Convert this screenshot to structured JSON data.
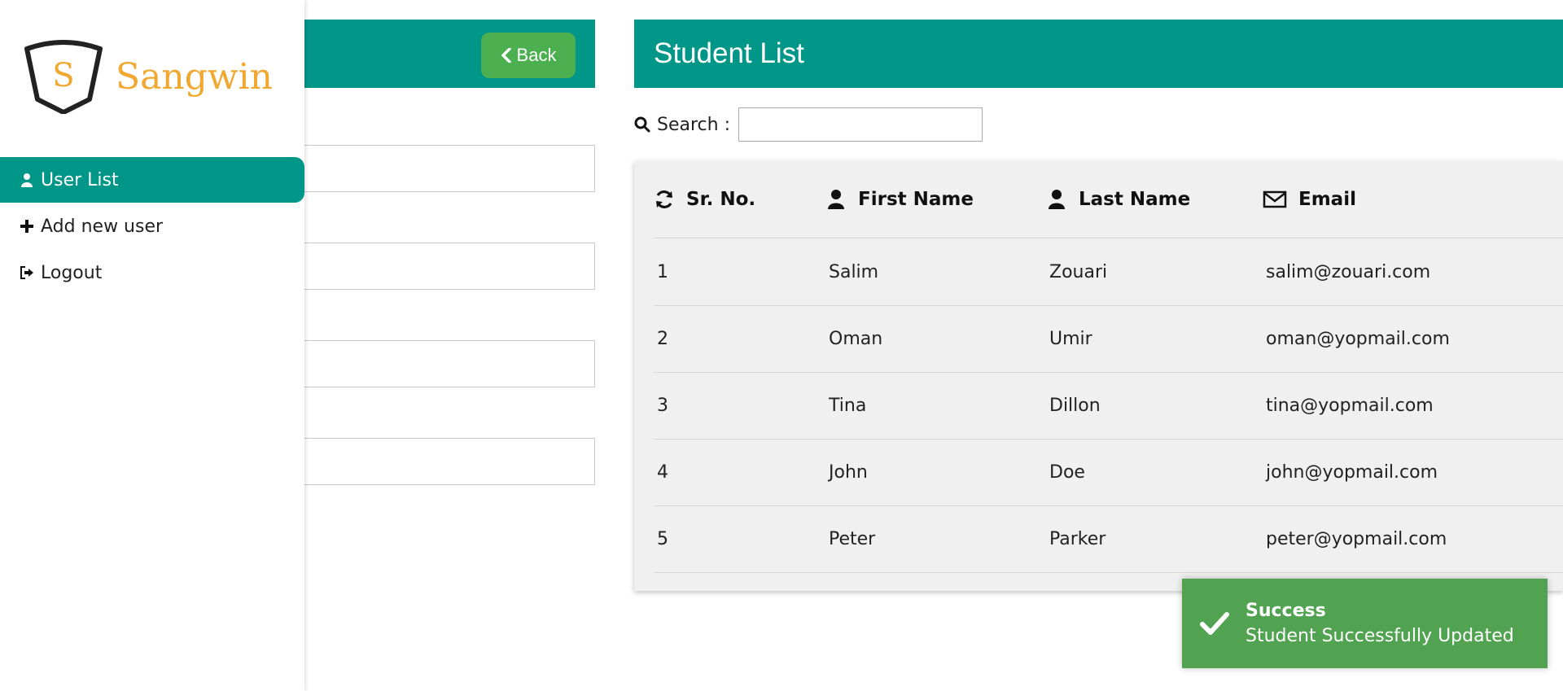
{
  "form_panel": {
    "back_label": "Back"
  },
  "student_list": {
    "title": "Student List",
    "search": {
      "label": "Search :",
      "value": ""
    },
    "columns": [
      "Sr. No.",
      "First Name",
      "Last Name",
      "Email"
    ],
    "rows": [
      [
        "1",
        "Salim",
        "Zouari",
        "salim@zouari.com"
      ],
      [
        "2",
        "Oman",
        "Umir",
        "oman@yopmail.com"
      ],
      [
        "3",
        "Tina",
        "Dillon",
        "tina@yopmail.com"
      ],
      [
        "4",
        "John",
        "Doe",
        "john@yopmail.com"
      ],
      [
        "5",
        "Peter",
        "Parker",
        "peter@yopmail.com"
      ]
    ]
  },
  "sidebar": {
    "logo_letter": "S",
    "logo_text": "Sangwin",
    "items": [
      {
        "label": "User List",
        "icon": "user-icon",
        "active": true
      },
      {
        "label": "Add new user",
        "icon": "plus-icon",
        "active": false
      },
      {
        "label": "Logout",
        "icon": "logout-icon",
        "active": false
      }
    ]
  },
  "toast": {
    "title": "Success",
    "message": "Student Successfully Updated"
  },
  "colors": {
    "primary": "#009688",
    "back_button": "#4caf50",
    "toast": "#51a351",
    "logo": "#f0a830"
  }
}
